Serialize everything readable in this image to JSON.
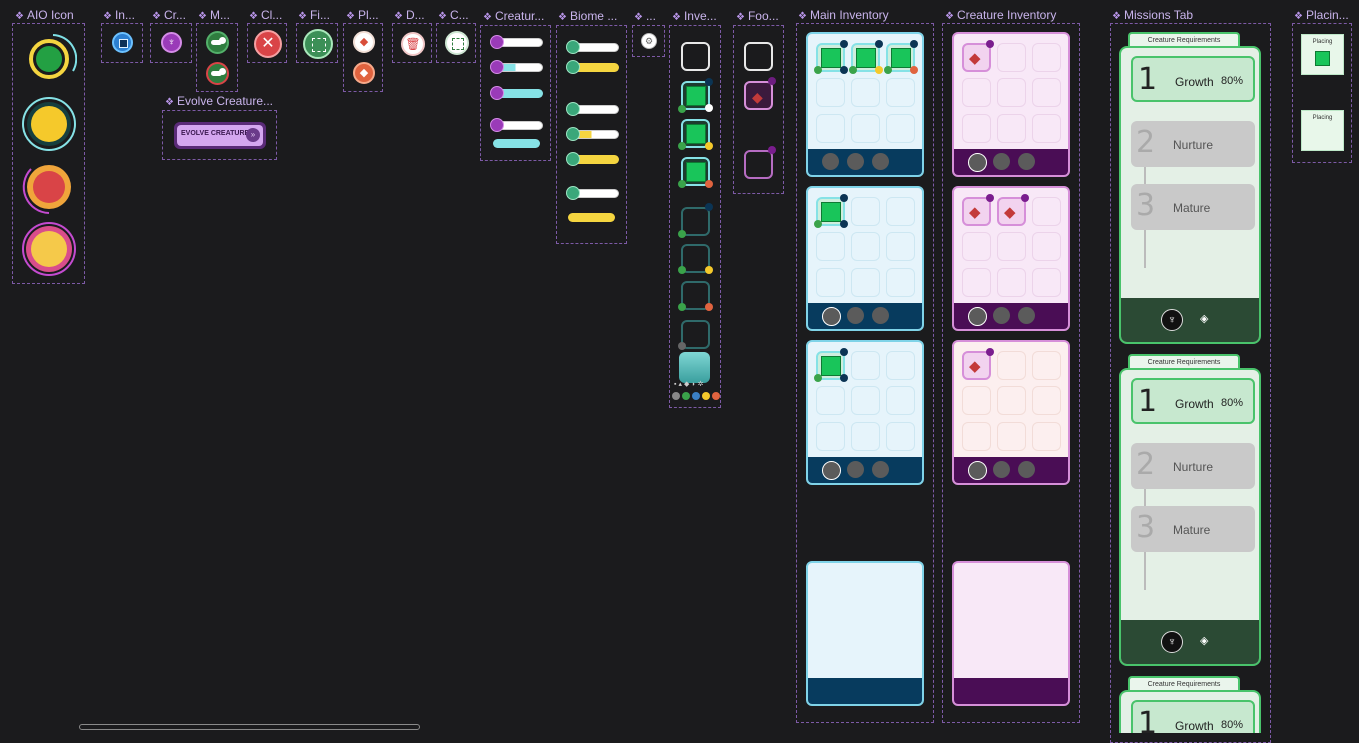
{
  "frames": {
    "aio_icon": "AIO Icon",
    "in": "In...",
    "cr": "Cr...",
    "m": "M...",
    "cl": "Cl...",
    "fi": "Fi...",
    "pl": "Pl...",
    "d": "D...",
    "c": "C...",
    "creature": "Creatur...",
    "biome": "Biome ...",
    "dots": "...",
    "inventory": "Inve...",
    "food": "Foo...",
    "main_inventory": "Main Inventory",
    "creature_inventory": "Creature Inventory",
    "missions_tab": "Missions Tab",
    "placing": "Placin...",
    "evolve": "Evolve Creature..."
  },
  "evolve_button_label": "EVOLVE CREATURE",
  "missions": [
    {
      "tab_label": "Creature Requirements",
      "steps": [
        {
          "num": "1",
          "label": "Growth",
          "value": "80%"
        },
        {
          "num": "2",
          "label": "Nurture"
        },
        {
          "num": "3",
          "label": "Mature"
        }
      ]
    },
    {
      "tab_label": "Creature Requirements",
      "steps": [
        {
          "num": "1",
          "label": "Growth",
          "value": "80%"
        },
        {
          "num": "2",
          "label": "Nurture"
        },
        {
          "num": "3",
          "label": "Mature"
        }
      ]
    },
    {
      "tab_label": "Creature Requirements",
      "steps": [
        {
          "num": "1",
          "label": "Growth",
          "value": "80%"
        }
      ]
    }
  ],
  "placing": [
    "Placing",
    "Placing"
  ],
  "colors": {
    "accent_purple": "#b895e8",
    "main_panel": "#e6f4fb",
    "main_border": "#7fd3e8",
    "main_footer": "#073b5e",
    "creature_panel": "#f8e8f7",
    "creature_border": "#d68fd9",
    "creature_footer": "#4a0d55",
    "green": "#19c55a",
    "yellow": "#f5d540",
    "red": "#d94447",
    "cyan": "#86e2e6"
  }
}
